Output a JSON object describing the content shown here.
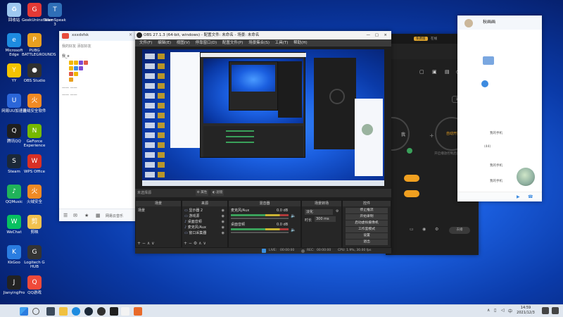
{
  "desktop": {
    "icons": [
      {
        "label": "回收站",
        "color": "#9ec8ef",
        "glyph": "♻"
      },
      {
        "label": "Microsoft Edge",
        "color": "#1d8be0",
        "glyph": "e"
      },
      {
        "label": "YY",
        "color": "#f5c400",
        "glyph": "Y"
      },
      {
        "label": "网易UU加速器",
        "color": "#2b66d9",
        "glyph": "U"
      },
      {
        "label": "腾讯QQ",
        "color": "#1f1f1f",
        "glyph": "Q"
      },
      {
        "label": "Steam",
        "color": "#1b2838",
        "glyph": "S"
      },
      {
        "label": "QQMusic",
        "color": "#20b35a",
        "glyph": "♪"
      },
      {
        "label": "WeChat",
        "color": "#07c160",
        "glyph": "W"
      },
      {
        "label": "KkGoo",
        "color": "#2a7de1",
        "glyph": "K"
      },
      {
        "label": "JianyingPro",
        "color": "#222222",
        "glyph": "J"
      },
      {
        "label": "GeekUninstaller",
        "color": "#e53935",
        "glyph": "G"
      },
      {
        "label": "PUBG BATTLEGROUNDS",
        "color": "#e8a020",
        "glyph": "P"
      },
      {
        "label": "OBS Studio",
        "color": "#303030",
        "glyph": "●"
      },
      {
        "label": "火绒安全软件",
        "color": "#f08a24",
        "glyph": "火"
      },
      {
        "label": "GeForce Experience",
        "color": "#76b900",
        "glyph": "N"
      },
      {
        "label": "WPS Office",
        "color": "#d93025",
        "glyph": "W"
      },
      {
        "label": "火绒安全",
        "color": "#f08a24",
        "glyph": "火"
      },
      {
        "label": "剪映",
        "color": "#f2c14e",
        "glyph": "剪"
      },
      {
        "label": "Logitech G HUB",
        "color": "#333333",
        "glyph": "G"
      },
      {
        "label": "QQ游戏",
        "color": "#f04a3a",
        "glyph": "Q"
      },
      {
        "label": "TeamSpeak 3",
        "color": "#2f6fb7",
        "glyph": "T"
      }
    ]
  },
  "chat_window": {
    "title": "xxxdsfsk",
    "toolbar": "我的好友 添加好友",
    "groups": [
      "我_e",
      "一一 一一",
      "一一 一一"
    ],
    "footer": "网易云音乐"
  },
  "obs": {
    "title": "OBS 27.1.3 (64-bit, windows) - 配置文件: 未命名 - 场景: 未命名",
    "menu": [
      "文件(F)",
      "编辑(E)",
      "视图(V)",
      "停靠窗口(D)",
      "配置文件(P)",
      "场景集合(S)",
      "工具(T)",
      "帮助(H)"
    ],
    "no_source": "未选择源",
    "props_btn": "属性",
    "filters_btn": "滤镜",
    "panels": {
      "scenes": {
        "title": "场景",
        "items": [
          "场景"
        ]
      },
      "sources": {
        "title": "来源",
        "items": [
          "显示器 2",
          "游戏源",
          "桌面音频",
          "麦克风/Aux",
          "窗口采集器"
        ]
      },
      "mixer": {
        "title": "混音器",
        "items": [
          {
            "name": "麦克风/Aux",
            "db": "0.0 dB"
          },
          {
            "name": "桌面音频",
            "db": "0.0 dB"
          }
        ]
      },
      "transitions": {
        "title": "场景转场",
        "type": "淡化",
        "duration_label": "时长",
        "duration": "300 ms"
      },
      "controls": {
        "title": "控件",
        "buttons": [
          "停止推流",
          "开始录制",
          "启动虚拟摄像机",
          "工作室模式",
          "设置",
          "退出"
        ]
      }
    },
    "status": {
      "live_label": "LIVE:",
      "live_time": "00:00:00",
      "rec_label": "REC:",
      "rec_time": "00:00:00",
      "cpu": "CPU: 1.9%, 30.00 fps"
    }
  },
  "dark_window": {
    "header_left": "免费版",
    "header_tag": "在线",
    "pill": "通话",
    "circle_left": "我",
    "circle_right": "自动开播",
    "caption": "开启播放控制后自动开播",
    "bottom_btn": "去播"
  },
  "right_window": {
    "title": "秋画画",
    "items": [
      "我的手机",
      "我的手机",
      "(44)",
      "我的手机"
    ]
  },
  "taskbar": {
    "time": "14:59",
    "date": "2021/12/3"
  }
}
